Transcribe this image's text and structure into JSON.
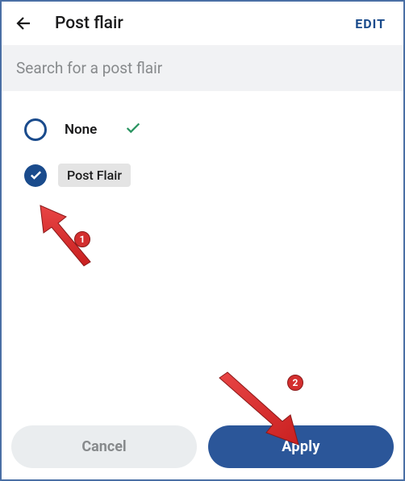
{
  "header": {
    "title": "Post flair",
    "edit_label": "EDIT"
  },
  "search": {
    "placeholder": "Search for a post flair"
  },
  "options": [
    {
      "label": "None",
      "selected": false,
      "has_check": true
    },
    {
      "label": "Post Flair",
      "selected": true,
      "is_pill": true
    }
  ],
  "buttons": {
    "cancel": "Cancel",
    "apply": "Apply"
  },
  "annotations": {
    "badge1": "1",
    "badge2": "2"
  }
}
